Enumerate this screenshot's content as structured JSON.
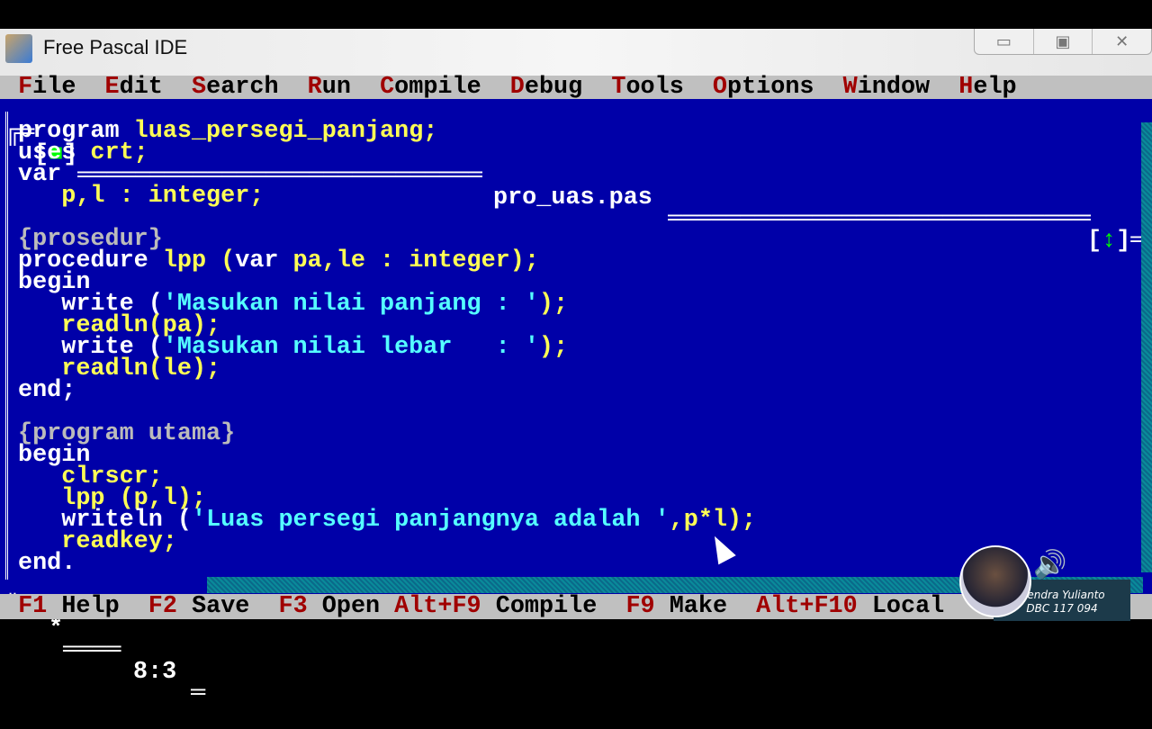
{
  "window": {
    "title": "Free Pascal IDE",
    "minimize": "▭",
    "maximize": "▣",
    "close": "✕"
  },
  "menu": [
    {
      "hot": "F",
      "rest": "ile"
    },
    {
      "hot": "E",
      "rest": "dit"
    },
    {
      "hot": "S",
      "rest": "earch"
    },
    {
      "hot": "R",
      "rest": "un"
    },
    {
      "hot": "C",
      "rest": "ompile"
    },
    {
      "hot": "D",
      "rest": "ebug"
    },
    {
      "hot": "T",
      "rest": "ools"
    },
    {
      "hot": "O",
      "rest": "ptions"
    },
    {
      "hot": "W",
      "rest": "indow"
    },
    {
      "hot": "H",
      "rest": "elp"
    }
  ],
  "editor": {
    "filename": "pro_uas.pas",
    "close_box": "[■]",
    "zoom_box": "[↕]",
    "cursor_pos": "8:3",
    "modified_marker": "*",
    "lines": [
      [
        [
          "program ",
          "kw"
        ],
        [
          "luas_persegi_panjang;",
          "id"
        ]
      ],
      [
        [
          "uses ",
          "kw"
        ],
        [
          "crt;",
          "id"
        ]
      ],
      [
        [
          "var",
          "kw"
        ]
      ],
      [
        [
          "   p,l : integer;",
          "id"
        ]
      ],
      [],
      [
        [
          "{prosedur}",
          "cm"
        ]
      ],
      [
        [
          "procedure ",
          "kw"
        ],
        [
          "lpp (",
          "id"
        ],
        [
          "var ",
          "kw"
        ],
        [
          "pa,le : integer);",
          "id"
        ]
      ],
      [
        [
          "begin",
          "kw"
        ]
      ],
      [
        [
          "   write (",
          "kw"
        ],
        [
          "'Masukan nilai panjang : '",
          "str"
        ],
        [
          ");",
          "id"
        ]
      ],
      [
        [
          "   readln(pa);",
          "id"
        ]
      ],
      [
        [
          "   write (",
          "kw"
        ],
        [
          "'Masukan nilai lebar   : '",
          "str"
        ],
        [
          ");",
          "id"
        ]
      ],
      [
        [
          "   readln(le);",
          "id"
        ]
      ],
      [
        [
          "end;",
          "kw"
        ]
      ],
      [],
      [
        [
          "{program utama}",
          "cm"
        ]
      ],
      [
        [
          "begin",
          "kw"
        ]
      ],
      [
        [
          "   clrscr;",
          "id"
        ]
      ],
      [
        [
          "   lpp (p,l);",
          "id"
        ]
      ],
      [
        [
          "   writeln (",
          "kw"
        ],
        [
          "'Luas persegi panjangnya adalah '",
          "str"
        ],
        [
          ",p*l);",
          "id"
        ]
      ],
      [
        [
          "   readkey;",
          "id"
        ]
      ],
      [
        [
          "end.",
          "kw"
        ]
      ]
    ]
  },
  "statusbar": [
    {
      "key": "F1",
      "label": "Help"
    },
    {
      "key": "F2",
      "label": "Save"
    },
    {
      "key": "F3",
      "label": "Open"
    },
    {
      "key": "Alt+F9",
      "label": "Compile"
    },
    {
      "key": "F9",
      "label": "Make"
    },
    {
      "key": "Alt+F10",
      "label": "Local"
    }
  ],
  "overlay": {
    "name": "Hendra Yulianto",
    "id": "DBC 117 094",
    "speaker_icon": "🔊"
  }
}
